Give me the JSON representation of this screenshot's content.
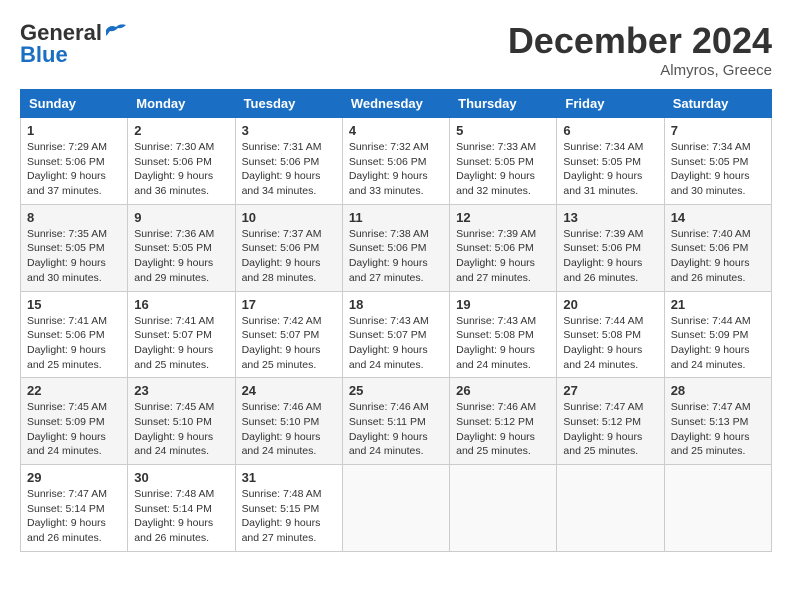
{
  "header": {
    "logo_line1": "General",
    "logo_line2": "Blue",
    "month": "December 2024",
    "location": "Almyros, Greece"
  },
  "columns": [
    "Sunday",
    "Monday",
    "Tuesday",
    "Wednesday",
    "Thursday",
    "Friday",
    "Saturday"
  ],
  "weeks": [
    [
      {
        "day": "1",
        "sunrise": "Sunrise: 7:29 AM",
        "sunset": "Sunset: 5:06 PM",
        "daylight": "Daylight: 9 hours and 37 minutes."
      },
      {
        "day": "2",
        "sunrise": "Sunrise: 7:30 AM",
        "sunset": "Sunset: 5:06 PM",
        "daylight": "Daylight: 9 hours and 36 minutes."
      },
      {
        "day": "3",
        "sunrise": "Sunrise: 7:31 AM",
        "sunset": "Sunset: 5:06 PM",
        "daylight": "Daylight: 9 hours and 34 minutes."
      },
      {
        "day": "4",
        "sunrise": "Sunrise: 7:32 AM",
        "sunset": "Sunset: 5:06 PM",
        "daylight": "Daylight: 9 hours and 33 minutes."
      },
      {
        "day": "5",
        "sunrise": "Sunrise: 7:33 AM",
        "sunset": "Sunset: 5:05 PM",
        "daylight": "Daylight: 9 hours and 32 minutes."
      },
      {
        "day": "6",
        "sunrise": "Sunrise: 7:34 AM",
        "sunset": "Sunset: 5:05 PM",
        "daylight": "Daylight: 9 hours and 31 minutes."
      },
      {
        "day": "7",
        "sunrise": "Sunrise: 7:34 AM",
        "sunset": "Sunset: 5:05 PM",
        "daylight": "Daylight: 9 hours and 30 minutes."
      }
    ],
    [
      {
        "day": "8",
        "sunrise": "Sunrise: 7:35 AM",
        "sunset": "Sunset: 5:05 PM",
        "daylight": "Daylight: 9 hours and 30 minutes."
      },
      {
        "day": "9",
        "sunrise": "Sunrise: 7:36 AM",
        "sunset": "Sunset: 5:05 PM",
        "daylight": "Daylight: 9 hours and 29 minutes."
      },
      {
        "day": "10",
        "sunrise": "Sunrise: 7:37 AM",
        "sunset": "Sunset: 5:06 PM",
        "daylight": "Daylight: 9 hours and 28 minutes."
      },
      {
        "day": "11",
        "sunrise": "Sunrise: 7:38 AM",
        "sunset": "Sunset: 5:06 PM",
        "daylight": "Daylight: 9 hours and 27 minutes."
      },
      {
        "day": "12",
        "sunrise": "Sunrise: 7:39 AM",
        "sunset": "Sunset: 5:06 PM",
        "daylight": "Daylight: 9 hours and 27 minutes."
      },
      {
        "day": "13",
        "sunrise": "Sunrise: 7:39 AM",
        "sunset": "Sunset: 5:06 PM",
        "daylight": "Daylight: 9 hours and 26 minutes."
      },
      {
        "day": "14",
        "sunrise": "Sunrise: 7:40 AM",
        "sunset": "Sunset: 5:06 PM",
        "daylight": "Daylight: 9 hours and 26 minutes."
      }
    ],
    [
      {
        "day": "15",
        "sunrise": "Sunrise: 7:41 AM",
        "sunset": "Sunset: 5:06 PM",
        "daylight": "Daylight: 9 hours and 25 minutes."
      },
      {
        "day": "16",
        "sunrise": "Sunrise: 7:41 AM",
        "sunset": "Sunset: 5:07 PM",
        "daylight": "Daylight: 9 hours and 25 minutes."
      },
      {
        "day": "17",
        "sunrise": "Sunrise: 7:42 AM",
        "sunset": "Sunset: 5:07 PM",
        "daylight": "Daylight: 9 hours and 25 minutes."
      },
      {
        "day": "18",
        "sunrise": "Sunrise: 7:43 AM",
        "sunset": "Sunset: 5:07 PM",
        "daylight": "Daylight: 9 hours and 24 minutes."
      },
      {
        "day": "19",
        "sunrise": "Sunrise: 7:43 AM",
        "sunset": "Sunset: 5:08 PM",
        "daylight": "Daylight: 9 hours and 24 minutes."
      },
      {
        "day": "20",
        "sunrise": "Sunrise: 7:44 AM",
        "sunset": "Sunset: 5:08 PM",
        "daylight": "Daylight: 9 hours and 24 minutes."
      },
      {
        "day": "21",
        "sunrise": "Sunrise: 7:44 AM",
        "sunset": "Sunset: 5:09 PM",
        "daylight": "Daylight: 9 hours and 24 minutes."
      }
    ],
    [
      {
        "day": "22",
        "sunrise": "Sunrise: 7:45 AM",
        "sunset": "Sunset: 5:09 PM",
        "daylight": "Daylight: 9 hours and 24 minutes."
      },
      {
        "day": "23",
        "sunrise": "Sunrise: 7:45 AM",
        "sunset": "Sunset: 5:10 PM",
        "daylight": "Daylight: 9 hours and 24 minutes."
      },
      {
        "day": "24",
        "sunrise": "Sunrise: 7:46 AM",
        "sunset": "Sunset: 5:10 PM",
        "daylight": "Daylight: 9 hours and 24 minutes."
      },
      {
        "day": "25",
        "sunrise": "Sunrise: 7:46 AM",
        "sunset": "Sunset: 5:11 PM",
        "daylight": "Daylight: 9 hours and 24 minutes."
      },
      {
        "day": "26",
        "sunrise": "Sunrise: 7:46 AM",
        "sunset": "Sunset: 5:12 PM",
        "daylight": "Daylight: 9 hours and 25 minutes."
      },
      {
        "day": "27",
        "sunrise": "Sunrise: 7:47 AM",
        "sunset": "Sunset: 5:12 PM",
        "daylight": "Daylight: 9 hours and 25 minutes."
      },
      {
        "day": "28",
        "sunrise": "Sunrise: 7:47 AM",
        "sunset": "Sunset: 5:13 PM",
        "daylight": "Daylight: 9 hours and 25 minutes."
      }
    ],
    [
      {
        "day": "29",
        "sunrise": "Sunrise: 7:47 AM",
        "sunset": "Sunset: 5:14 PM",
        "daylight": "Daylight: 9 hours and 26 minutes."
      },
      {
        "day": "30",
        "sunrise": "Sunrise: 7:48 AM",
        "sunset": "Sunset: 5:14 PM",
        "daylight": "Daylight: 9 hours and 26 minutes."
      },
      {
        "day": "31",
        "sunrise": "Sunrise: 7:48 AM",
        "sunset": "Sunset: 5:15 PM",
        "daylight": "Daylight: 9 hours and 27 minutes."
      },
      null,
      null,
      null,
      null
    ]
  ]
}
